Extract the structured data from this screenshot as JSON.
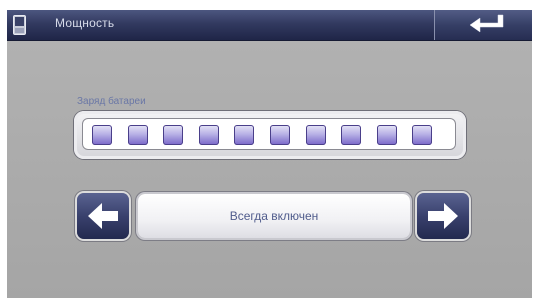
{
  "window": {
    "title": "Мощность"
  },
  "battery": {
    "label": "Заряд батареи",
    "segments_total": 10,
    "segments_filled": 10
  },
  "mode": {
    "value": "Всегда включен"
  },
  "icons": {
    "device": "device-icon",
    "back": "return-arrow-icon",
    "prev": "arrow-left-icon",
    "next": "arrow-right-icon"
  },
  "colors": {
    "titlebar": "#323a60",
    "background": "#a9a9a9",
    "segment_fill": "#7865c8",
    "label_text": "#6a77a6"
  }
}
